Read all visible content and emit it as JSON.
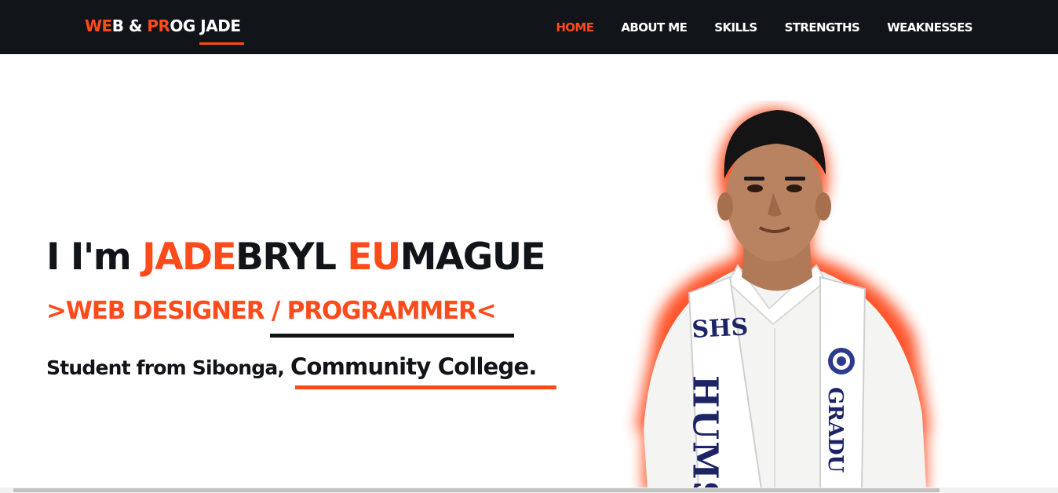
{
  "brand": {
    "part1_accent": "WE",
    "part2": "B & ",
    "part3_accent": "PR",
    "part4": "OG JADE"
  },
  "nav": {
    "items": [
      {
        "label": "HOME",
        "active": true
      },
      {
        "label": "ABOUT ME",
        "active": false
      },
      {
        "label": "SKILLS",
        "active": false
      },
      {
        "label": "STRENGTHS",
        "active": false
      },
      {
        "label": "WEAKNESSES",
        "active": false
      }
    ]
  },
  "hero": {
    "title_prefix": "I I'm ",
    "title_first_accent": "JADE",
    "title_first_rest": "BRYL ",
    "title_last_accent": "EU",
    "title_last_rest": "MAGUE",
    "role": ">WEB DESIGNER / PROGRAMMER<",
    "sub_prefix": "Student from Sibonga, ",
    "sub_college": "Community College.",
    "portrait_icon": "person-photo",
    "sash_text_left": "SHS",
    "sash_text_left_big": "HUMS",
    "sash_text_right": "GRADU"
  },
  "colors": {
    "accent": "#ff4a1c",
    "dark": "#111418"
  }
}
